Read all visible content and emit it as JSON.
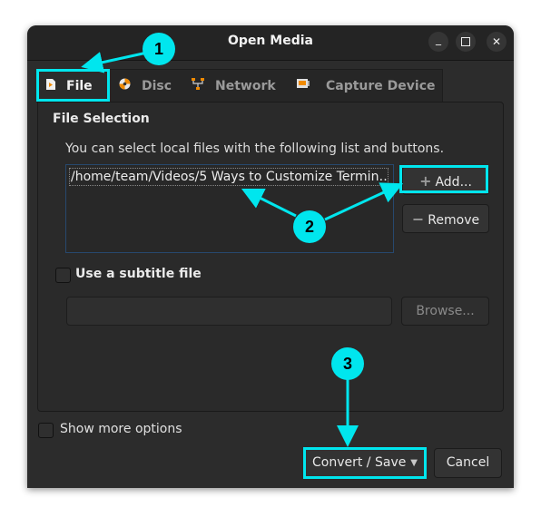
{
  "window": {
    "title": "Open Media",
    "controls": {
      "minimize": "_",
      "maximize": "☐",
      "close": "✕"
    }
  },
  "tabs": [
    {
      "label": "File",
      "icon": "file-icon",
      "active": true
    },
    {
      "label": "Disc",
      "icon": "disc-icon",
      "active": false
    },
    {
      "label": "Network",
      "icon": "network-icon",
      "active": false
    },
    {
      "label": "Capture Device",
      "icon": "capture-device-icon",
      "active": false
    }
  ],
  "file_selection": {
    "title": "File Selection",
    "description": "You can select local files with the following list and buttons.",
    "files": [
      "/home/team/Videos/5 Ways to Customize Termin…"
    ],
    "add_label": "Add...",
    "remove_label": "Remove"
  },
  "subtitle": {
    "label": "Use a subtitle file",
    "checked": false,
    "path_value": "",
    "browse_label": "Browse..."
  },
  "show_more_options": {
    "label": "Show more options",
    "checked": false
  },
  "footer": {
    "convert_label": "Convert / Save",
    "cancel_label": "Cancel"
  },
  "annotations": {
    "color": "#00e6ee",
    "callouts": [
      "1",
      "2",
      "3"
    ]
  }
}
